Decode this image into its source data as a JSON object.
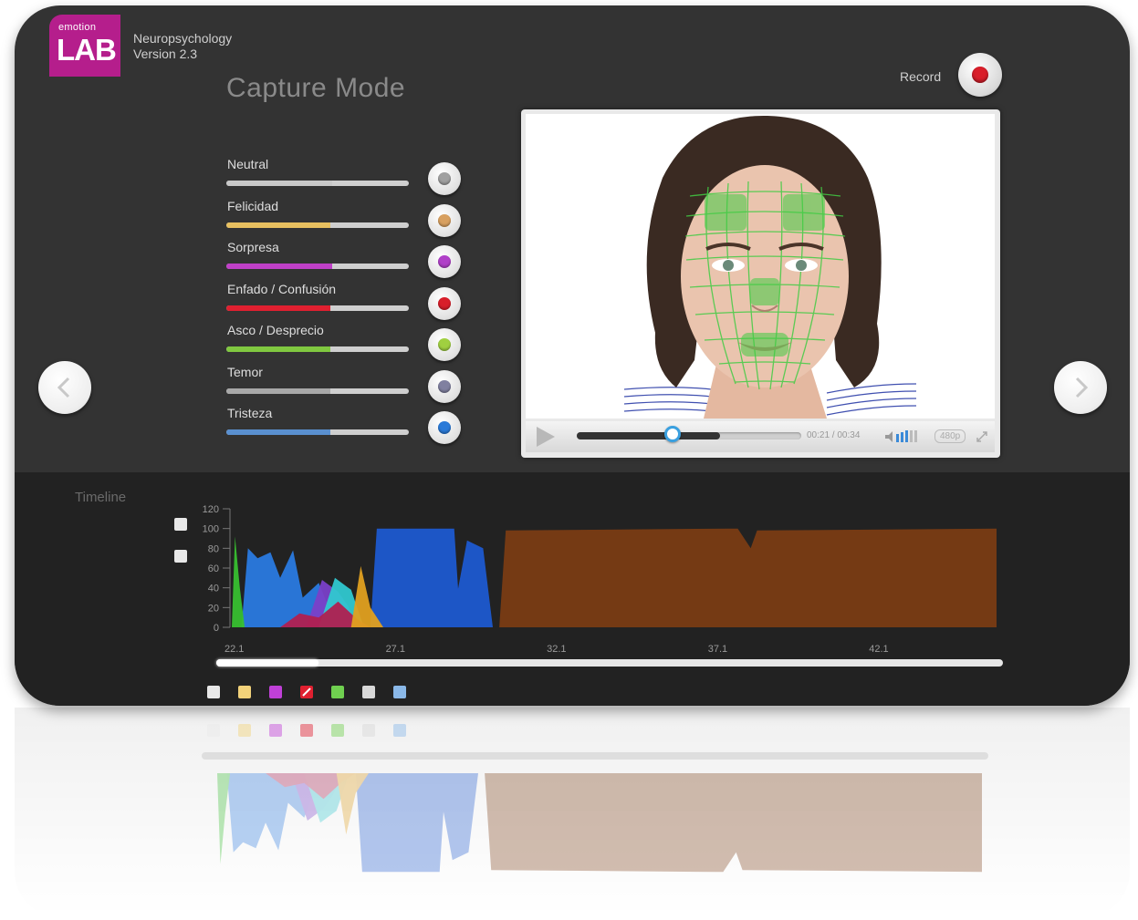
{
  "app": {
    "logo_small": "emotion",
    "logo_main": "LAB",
    "name": "Neuropsychology",
    "version": "Version 2.3",
    "mode_title": "Capture Mode"
  },
  "record": {
    "label": "Record",
    "color": "#d91e2a"
  },
  "emotions": [
    {
      "label": "Neutral",
      "color": "#c8c8c8",
      "level": 0.58
    },
    {
      "label": "Felicidad",
      "color": "#e8c060",
      "level": 0.57
    },
    {
      "label": "Sorpresa",
      "color": "#c040c8",
      "level": 0.58
    },
    {
      "label": "Enfado / Confusión",
      "color": "#e02030",
      "level": 0.57
    },
    {
      "label": "Asco / Desprecio",
      "color": "#80c840",
      "level": 0.57
    },
    {
      "label": "Temor",
      "color": "#a8a8a8",
      "level": 0.57
    },
    {
      "label": "Tristeza",
      "color": "#5a90d0",
      "level": 0.57
    }
  ],
  "emotion_knob_dots": [
    "#a0a0a0",
    "#d8a060",
    "#b040c8",
    "#d81e2a",
    "#a0d040",
    "#8080a0",
    "#2a7ad8"
  ],
  "video": {
    "time": "00:21 / 00:34",
    "quality": "480p",
    "progress": 0.44,
    "buffered": 0.64,
    "volume_icon": "volume-icon",
    "fullscreen_icon": "fullscreen-icon",
    "play_icon": "play-icon"
  },
  "timeline": {
    "label": "Timeline",
    "range_fill": 0.13
  },
  "chart_data": {
    "type": "area",
    "ylim": [
      0,
      120
    ],
    "yticks": [
      "120",
      "100",
      "80",
      "60",
      "40",
      "20",
      "0"
    ],
    "xticks": [
      "22.1",
      "27.1",
      "32.1",
      "37.1",
      "42.1"
    ],
    "xlim": [
      22.1,
      46.0
    ],
    "series": [
      {
        "color": "#7a3c14",
        "x": [
          30.4,
          30.6,
          37.6,
          37.8,
          38.2,
          38.4,
          46.0,
          46.0
        ],
        "values": [
          0,
          98,
          100,
          100,
          80,
          98,
          100,
          0
        ]
      },
      {
        "color": "#1e5ad0",
        "x": [
          26.4,
          26.6,
          29.0,
          29.2,
          28.9,
          29.4,
          29.9,
          30.2
        ],
        "values": [
          0,
          100,
          100,
          0,
          0,
          88,
          80,
          0
        ]
      },
      {
        "color": "#2a7ae0",
        "x": [
          22.4,
          22.6,
          22.9,
          23.3,
          23.6,
          24.0,
          24.3,
          24.8,
          25.2,
          25.6
        ],
        "values": [
          0,
          80,
          70,
          76,
          50,
          78,
          30,
          45,
          12,
          0
        ]
      },
      {
        "color": "#7a40c8",
        "x": [
          24.4,
          24.9,
          25.4,
          25.7,
          26.0
        ],
        "values": [
          0,
          48,
          36,
          22,
          0
        ]
      },
      {
        "color": "#30c8d0",
        "x": [
          24.8,
          25.3,
          25.8,
          26.2
        ],
        "values": [
          0,
          50,
          38,
          0
        ]
      },
      {
        "color": "#38c030",
        "x": [
          22.1,
          22.2,
          22.35,
          22.5
        ],
        "values": [
          0,
          92,
          40,
          0
        ]
      },
      {
        "color": "#b02050",
        "x": [
          23.6,
          24.2,
          24.8,
          25.4,
          26.0,
          26.4
        ],
        "values": [
          0,
          14,
          10,
          26,
          8,
          0
        ]
      },
      {
        "color": "#e0a020",
        "x": [
          25.8,
          26.1,
          26.4,
          26.8
        ],
        "values": [
          0,
          62,
          20,
          0
        ]
      }
    ]
  },
  "legend_colors": [
    "#e8e8e8",
    "#f2d27a",
    "#c040d8",
    "#e02030",
    "#70d050",
    "#d8d8d8",
    "#8ab8e8"
  ],
  "nav": {
    "prev_icon": "chevron-left-icon",
    "next_icon": "chevron-right-icon"
  }
}
